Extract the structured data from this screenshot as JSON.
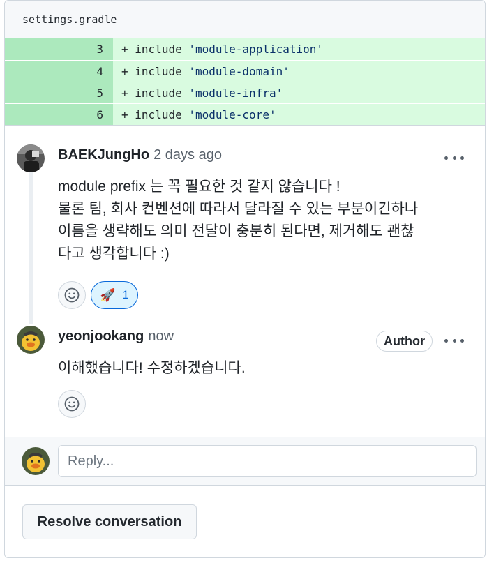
{
  "file": {
    "name": "settings.gradle"
  },
  "diff_lines": [
    {
      "line": "3",
      "sign": "+",
      "keyword": "include",
      "value": "'module-application'"
    },
    {
      "line": "4",
      "sign": "+",
      "keyword": "include",
      "value": "'module-domain'"
    },
    {
      "line": "5",
      "sign": "+",
      "keyword": "include",
      "value": "'module-infra'"
    },
    {
      "line": "6",
      "sign": "+",
      "keyword": "include",
      "value": "'module-core'"
    }
  ],
  "comments": [
    {
      "author": "BAEKJungHo",
      "time": "2 days ago",
      "lines": [
        "module prefix 는 꼭 필요한 것 같지 않습니다 !",
        "물론 팀, 회사 컨벤션에 따라서 달라질 수 있는 부분이긴하나",
        "이름을 생략해도 의미 전달이 충분히 된다면, 제거해도 괜찮",
        "다고 생각합니다 :)"
      ],
      "reaction": {
        "icon": "rocket-emoji",
        "emoji": "🚀",
        "count": "1"
      }
    },
    {
      "author": "yeonjookang",
      "time": "now",
      "badge": "Author",
      "lines": [
        "이해했습니다! 수정하겠습니다."
      ]
    }
  ],
  "reply": {
    "placeholder": "Reply..."
  },
  "actions": {
    "resolve_label": "Resolve conversation"
  },
  "colors": {
    "diff_added_gutter": "#ace9bd",
    "diff_added_code": "#d9fbe0",
    "reaction_active": "#ddf4ff",
    "link_blue": "#0969da"
  }
}
